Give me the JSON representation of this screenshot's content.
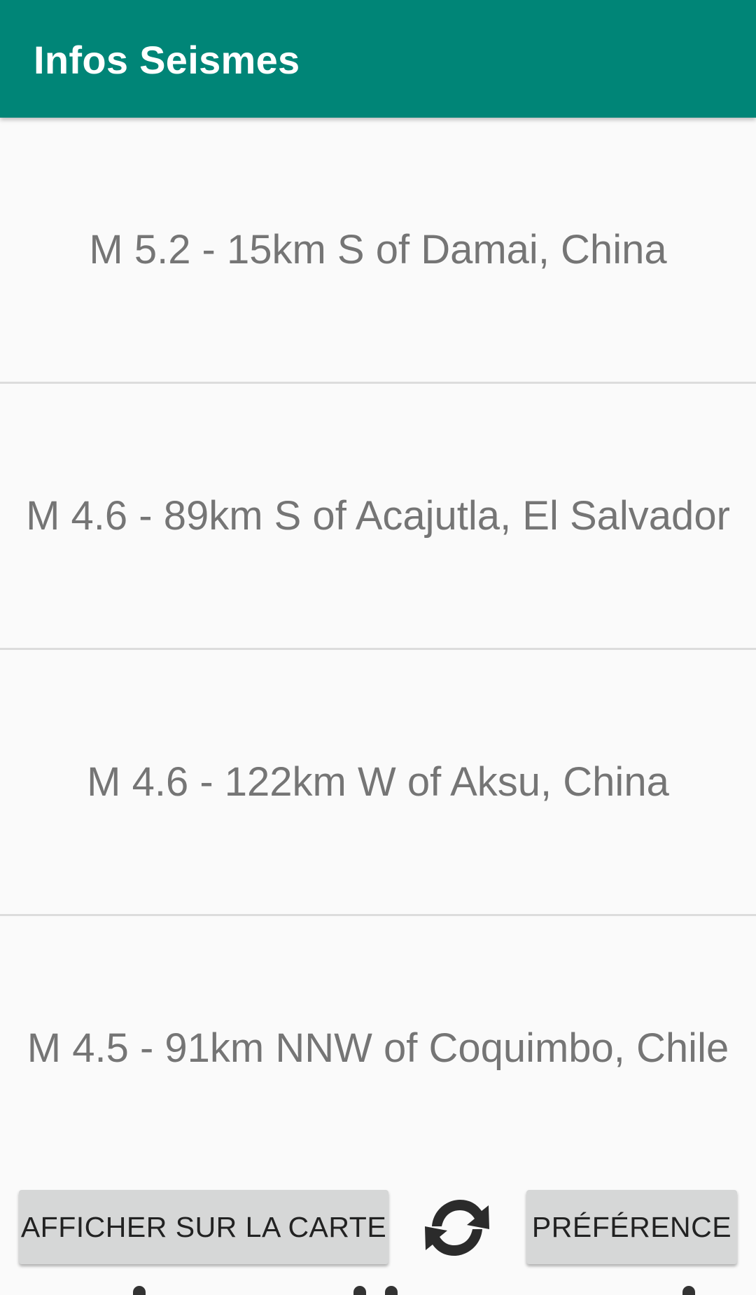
{
  "app": {
    "title": "Infos Seismes",
    "accent_color": "#008577"
  },
  "earthquakes": [
    {
      "label": "M 5.2 - 15km S of Damai, China"
    },
    {
      "label": "M 4.6 - 89km S of Acajutla, El Salvador"
    },
    {
      "label": "M 4.6 - 122km W of Aksu, China"
    },
    {
      "label": "M 4.5 - 91km NNW of Coquimbo, Chile"
    }
  ],
  "bottom_bar": {
    "map_button_label": "AFFICHER SUR LA CARTE",
    "refresh_icon": "refresh-icon",
    "preference_button_label": "PRÉFÉRENCE"
  }
}
